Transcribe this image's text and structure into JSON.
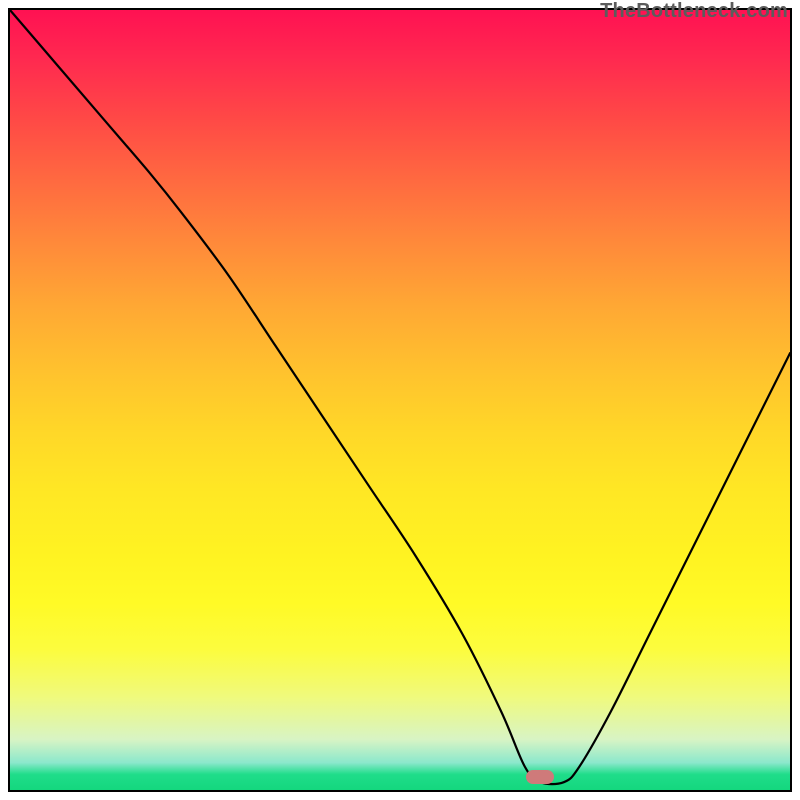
{
  "watermark_text": "TheBottleneck.com",
  "marker": {
    "x_pct": 68,
    "y_pct": 99
  },
  "chart_data": {
    "type": "line",
    "title": "",
    "xlabel": "",
    "ylabel": "",
    "xlim": [
      0,
      100
    ],
    "ylim": [
      0,
      100
    ],
    "series": [
      {
        "name": "bottleneck-curve",
        "x": [
          0,
          6,
          12,
          18,
          22,
          28,
          34,
          40,
          46,
          52,
          58,
          63,
          66,
          68,
          71,
          73,
          77,
          82,
          88,
          94,
          100
        ],
        "y": [
          100,
          93,
          86,
          79,
          74,
          66,
          57,
          48,
          39,
          30,
          20,
          10,
          3,
          1,
          1,
          3,
          10,
          20,
          32,
          44,
          56
        ]
      }
    ],
    "annotations": [
      {
        "type": "marker",
        "x": 68,
        "y": 1,
        "label": "optimal-point"
      }
    ],
    "background_gradient": {
      "top_color": "#ff1152",
      "mid_color": "#ffe824",
      "bottom_color": "#14d77e"
    }
  }
}
